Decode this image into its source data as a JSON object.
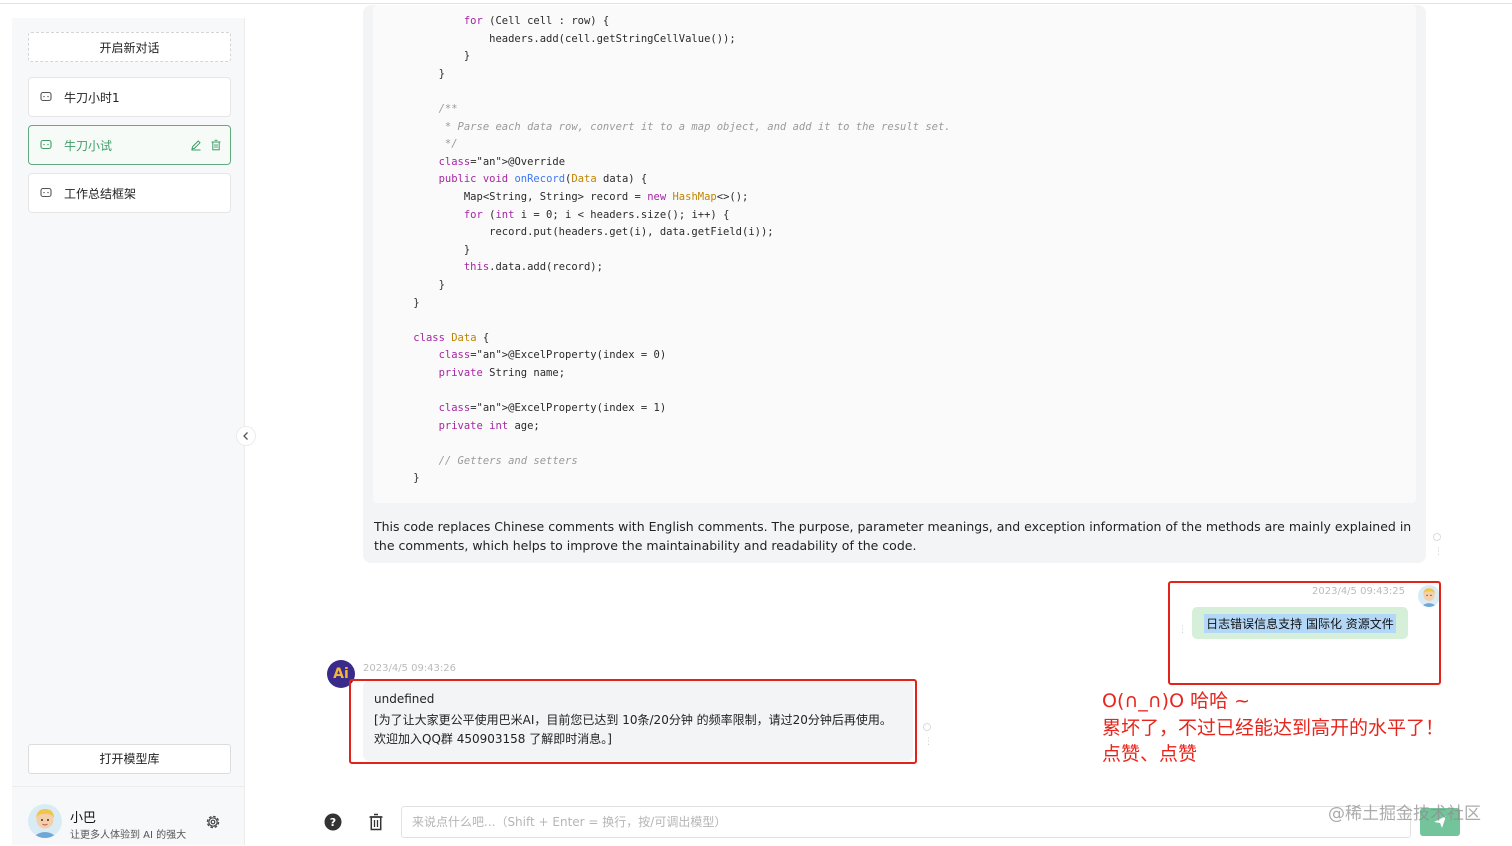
{
  "sidebar": {
    "new_chat_label": "开启新对话",
    "conversations": [
      {
        "label": "牛刀小时1"
      },
      {
        "label": "牛刀小试"
      },
      {
        "label": "工作总结框架"
      }
    ],
    "open_library_label": "打开模型库",
    "user": {
      "name": "小巴",
      "subtitle": "让更多人体验到 AI 的强大"
    }
  },
  "code_lines": [
    "            for (Cell cell : row) {",
    "                headers.add(cell.getStringCellValue());",
    "            }",
    "        }",
    "",
    "        /**",
    "         * Parse each data row, convert it to a map object, and add it to the result set.",
    "         */",
    "        @Override",
    "        public void onRecord(Data data) {",
    "            Map<String, String> record = new HashMap<>();",
    "            for (int i = 0; i < headers.size(); i++) {",
    "                record.put(headers.get(i), data.getField(i));",
    "            }",
    "            this.data.add(record);",
    "        }",
    "    }",
    "",
    "    class Data {",
    "        @ExcelProperty(index = 0)",
    "        private String name;",
    "",
    "        @ExcelProperty(index = 1)",
    "        private int age;",
    "",
    "        // Getters and setters",
    "    }"
  ],
  "ai_explanation": "This code replaces Chinese comments with English comments. The purpose, parameter meanings, and exception information of the methods are mainly explained in the comments, which helps to improve the maintainability and readability of the code.",
  "user_message": {
    "timestamp": "2023/4/5 09:43:25",
    "text": "日志错误信息支持 国际化 资源文件"
  },
  "ai_reply": {
    "avatar_text": "Ai",
    "timestamp": "2023/4/5 09:43:26",
    "lines": [
      "undefined",
      "[为了让大家更公平使用巴米AI，目前您已达到 10条/20分钟 的频率限制，请过20分钟后再使用。",
      "欢迎加入QQ群 450903158 了解即时消息。]"
    ]
  },
  "annotation": {
    "line1": "O(∩_∩)O 哈哈 ~",
    "line2": "累坏了，不过已经能达到高开的水平了！",
    "line3": "点赞、点赞"
  },
  "input": {
    "placeholder": "来说点什么吧...（Shift + Enter = 换行，按/可调出模型）"
  },
  "watermark": "@稀土掘金技术社区",
  "colors": {
    "accent_green": "#3f9c68",
    "annotation_red": "#e2231a",
    "user_bubble": "#d6efd9",
    "send_button": "#73c49a"
  }
}
